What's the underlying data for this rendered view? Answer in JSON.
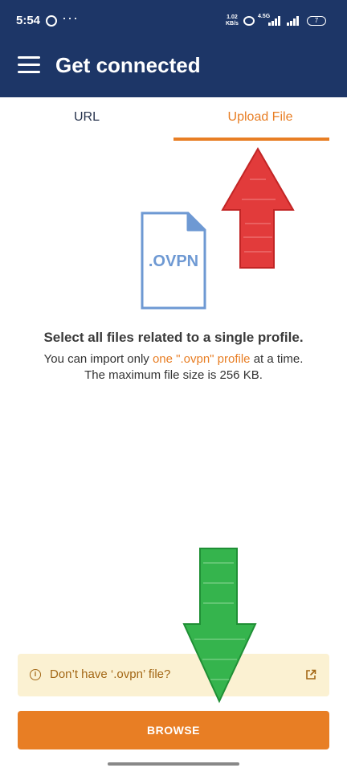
{
  "status_bar": {
    "time": "5:54",
    "network_speed_value": "1.02",
    "network_speed_unit": "KB/s",
    "network_type": "4.5G",
    "battery_level": "7",
    "overflow_symbol": "···"
  },
  "app_bar": {
    "title": "Get connected",
    "menu_icon": "hamburger-menu-icon"
  },
  "tabs": [
    {
      "label": "URL",
      "selected": false
    },
    {
      "label": "Upload File",
      "selected": true
    }
  ],
  "file_icon_label": ".OVPN",
  "instructions": {
    "heading": "Select all files related to a single profile.",
    "line1_prefix": "You can import only ",
    "line1_link": "one \".ovpn\" profile",
    "line1_suffix": " at a time.",
    "line2": "The maximum file size is 256 KB."
  },
  "notice": {
    "text": "Don’t have ‘.ovpn’ file?",
    "info_icon": "info-icon",
    "external_icon": "external-link-icon"
  },
  "browse_button": {
    "label": "BROWSE"
  },
  "colors": {
    "primary_dark": "#1d3667",
    "accent": "#e87e24",
    "notice_bg": "#fbf1d2",
    "notice_text": "#a36715",
    "file_icon": "#6e99d3",
    "annotation_up": "#e23b3b",
    "annotation_down": "#35b44d"
  }
}
